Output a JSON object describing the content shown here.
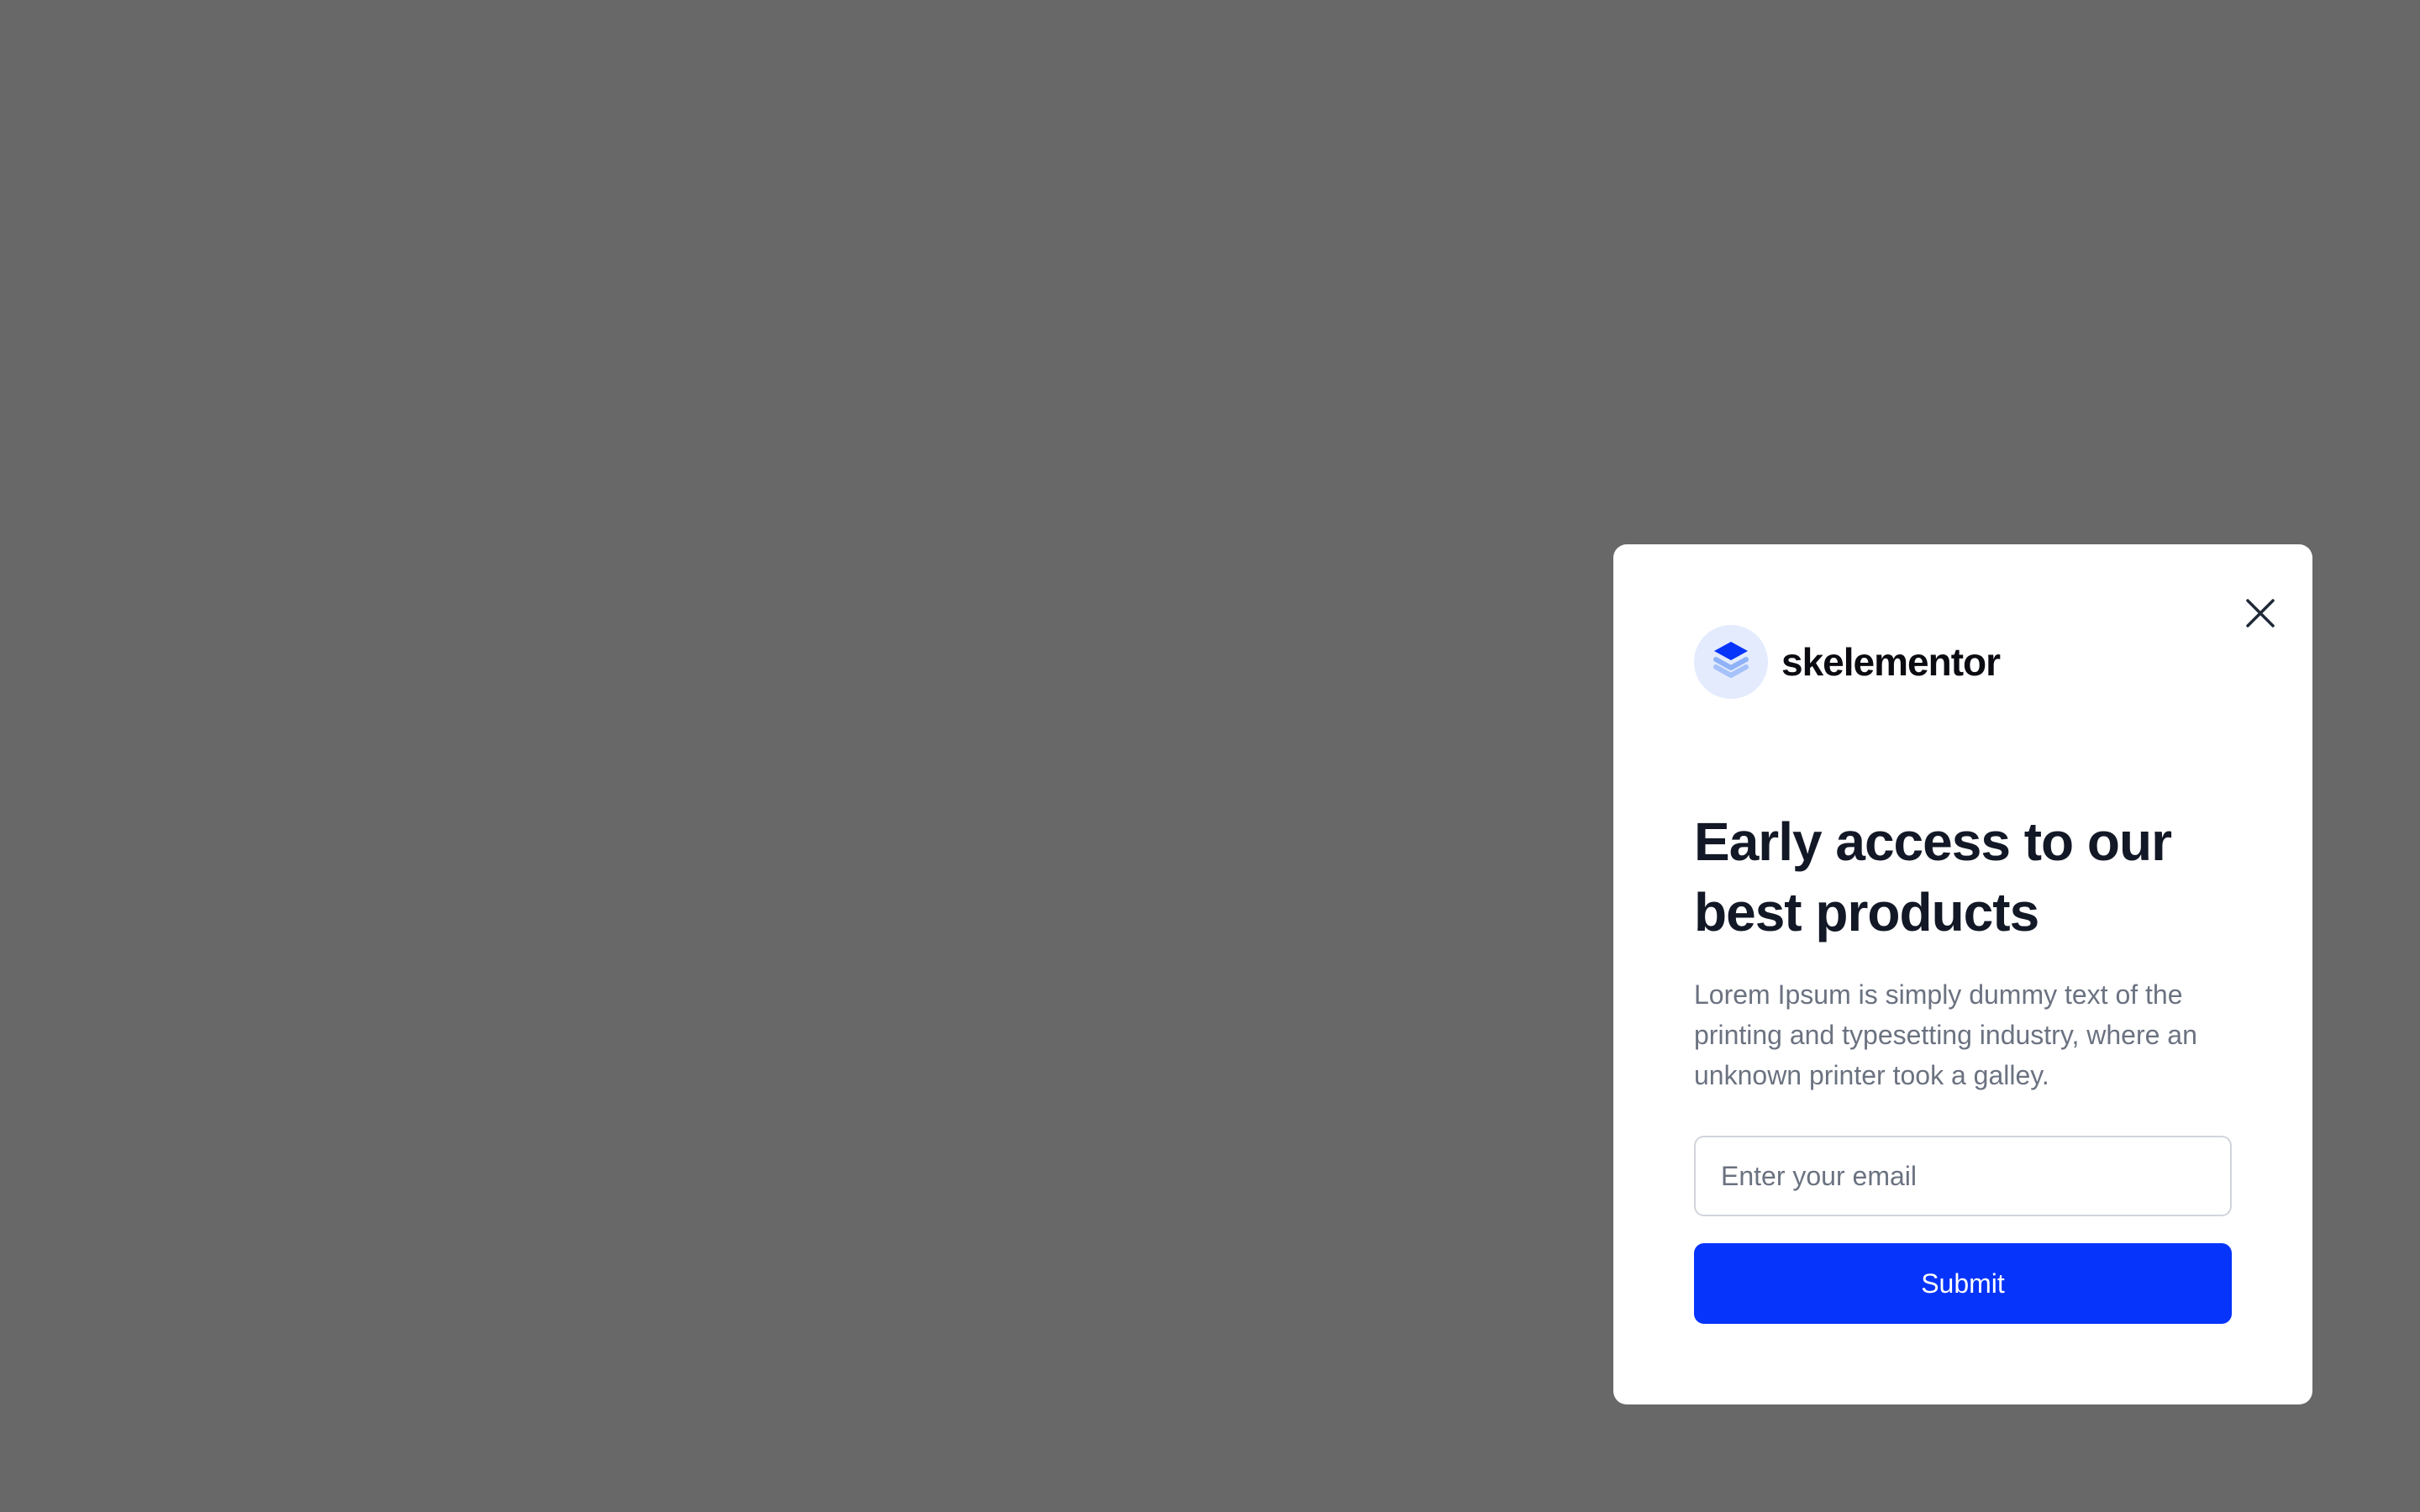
{
  "overlay": {
    "background_color": "#686868"
  },
  "modal": {
    "close_icon": "close-icon",
    "brand": {
      "icon": "stacked-layers-icon",
      "name": "skelementor"
    },
    "headline": "Early access to our best products",
    "description": "Lorem Ipsum is simply dummy text of the printing and typesetting industry, where an unknown printer took a galley.",
    "email": {
      "value": "",
      "placeholder": "Enter your email"
    },
    "submit_label": "Submit"
  },
  "colors": {
    "accent": "#0634FA",
    "logo_badge": "#E3EBFD",
    "heading": "#121826",
    "body_text": "#6B7280",
    "input_border": "#D1D5DB"
  }
}
